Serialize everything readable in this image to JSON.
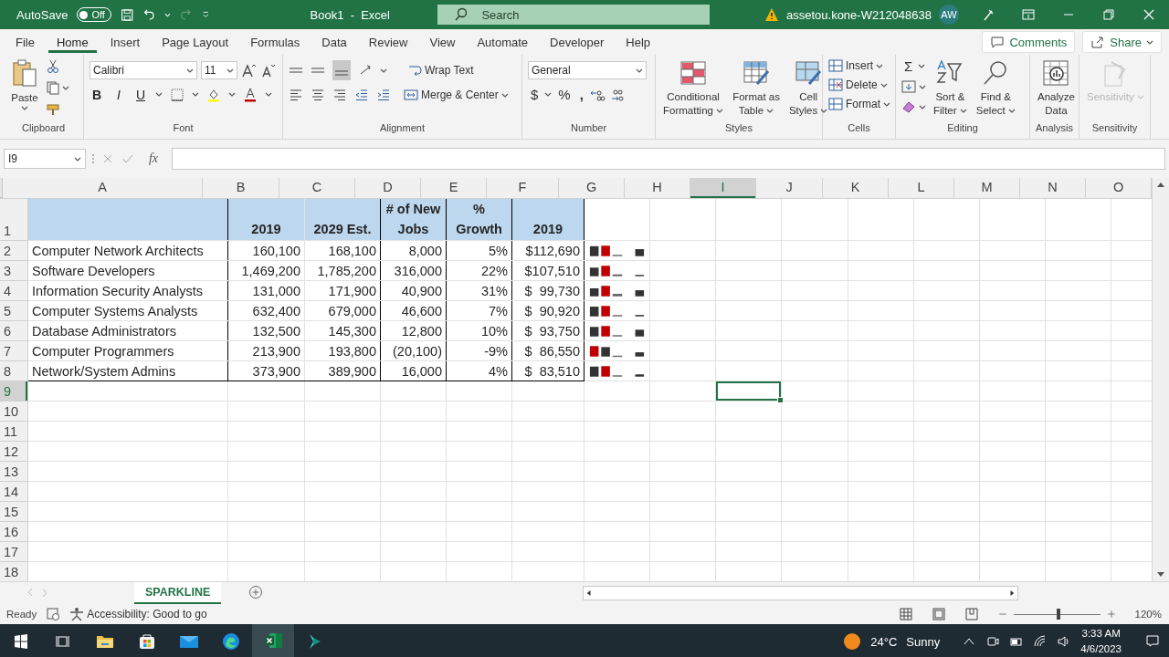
{
  "title_bar": {
    "autosave": {
      "label": "AutoSave",
      "on": false,
      "state_text": "Off"
    },
    "title": "Book1  -  Excel",
    "search": {
      "placeholder": "Search"
    },
    "account": "assetou.kone-W212048638",
    "avatar": "AW"
  },
  "menu": {
    "tabs": [
      {
        "label": "File",
        "selected": false
      },
      {
        "label": "Home",
        "selected": true
      },
      {
        "label": "Insert",
        "selected": false
      },
      {
        "label": "Page Layout",
        "selected": false
      },
      {
        "label": "Formulas",
        "selected": false
      },
      {
        "label": "Data",
        "selected": false
      },
      {
        "label": "Review",
        "selected": false
      },
      {
        "label": "View",
        "selected": false
      },
      {
        "label": "Automate",
        "selected": false
      },
      {
        "label": "Developer",
        "selected": false
      },
      {
        "label": "Help",
        "selected": false
      }
    ],
    "comments": "Comments",
    "share": "Share"
  },
  "ribbon": [
    {
      "kind": "clipboard",
      "name": "Clipboard",
      "paste": "Paste"
    },
    {
      "kind": "font",
      "name": "Font",
      "font_name": "Calibri",
      "font_size": "11",
      "styles": [
        "B",
        "I",
        "U"
      ]
    },
    {
      "kind": "alignment",
      "name": "Alignment",
      "wrap": "Wrap Text",
      "merge": "Merge & Center"
    },
    {
      "kind": "number",
      "name": "Number",
      "format": "General",
      "symbols": [
        "$",
        "%",
        ","
      ]
    },
    {
      "kind": "large",
      "name": "Styles",
      "buttons": [
        {
          "lines": [
            "Conditional",
            "Formatting"
          ],
          "caret": true,
          "disabled": false
        },
        {
          "lines": [
            "Format as",
            "Table"
          ],
          "caret": true,
          "disabled": false
        },
        {
          "lines": [
            "Cell",
            "Styles"
          ],
          "caret": true,
          "disabled": false
        }
      ]
    },
    {
      "kind": "cells",
      "name": "Cells",
      "buttons": [
        "Insert",
        "Delete",
        "Format"
      ]
    },
    {
      "kind": "editing",
      "name": "Editing",
      "sum": "Σ",
      "buttons": [
        {
          "lines": [
            "Sort &",
            "Filter"
          ],
          "caret": true,
          "disabled": false
        },
        {
          "lines": [
            "Find &",
            "Select"
          ],
          "caret": true,
          "disabled": false
        }
      ]
    },
    {
      "kind": "large",
      "name": "Analysis",
      "buttons": [
        {
          "lines": [
            "Analyze",
            "Data"
          ],
          "caret": false,
          "disabled": false
        }
      ]
    },
    {
      "kind": "large",
      "name": "Sensitivity",
      "buttons": [
        {
          "lines": [
            "Sensitivity"
          ],
          "caret": true,
          "disabled": true
        }
      ]
    }
  ],
  "formula_bar": {
    "name_box": "I9",
    "fx": "fx"
  },
  "columns": [
    {
      "label": "A",
      "selected": false
    },
    {
      "label": "B",
      "selected": false
    },
    {
      "label": "C",
      "selected": false
    },
    {
      "label": "D",
      "selected": false
    },
    {
      "label": "E",
      "selected": false
    },
    {
      "label": "F",
      "selected": false
    },
    {
      "label": "G",
      "selected": false
    },
    {
      "label": "H",
      "selected": false
    },
    {
      "label": "I",
      "selected": true
    },
    {
      "label": "J",
      "selected": false
    },
    {
      "label": "K",
      "selected": false
    },
    {
      "label": "L",
      "selected": false
    },
    {
      "label": "M",
      "selected": false
    },
    {
      "label": "N",
      "selected": false
    },
    {
      "label": "O",
      "selected": false
    }
  ],
  "rows": [
    {
      "label": "1",
      "selected": false,
      "kind": "header",
      "cells": [
        "2019",
        "2029 Est.",
        "# of New\nJobs",
        "%\nGrowth",
        "2019"
      ]
    },
    {
      "label": "2",
      "selected": false,
      "kind": "data",
      "cells": [
        "Computer Network Architects",
        "160,100",
        "168,100",
        "8,000",
        "5%",
        "$112,690"
      ]
    },
    {
      "label": "3",
      "selected": false,
      "kind": "data",
      "cells": [
        "Software Developers",
        "1,469,200",
        "1,785,200",
        "316,000",
        "22%",
        "$107,510"
      ]
    },
    {
      "label": "4",
      "selected": false,
      "kind": "data",
      "cells": [
        "Information Security Analysts",
        "131,000",
        "171,900",
        "40,900",
        "31%",
        "$  99,730"
      ]
    },
    {
      "label": "5",
      "selected": false,
      "kind": "data",
      "cells": [
        "Computer Systems Analysts",
        "632,400",
        "679,000",
        "46,600",
        "7%",
        "$  90,920"
      ]
    },
    {
      "label": "6",
      "selected": false,
      "kind": "data",
      "cells": [
        "Database Administrators",
        "132,500",
        "145,300",
        "12,800",
        "10%",
        "$  93,750"
      ]
    },
    {
      "label": "7",
      "selected": false,
      "kind": "data",
      "cells": [
        "Computer Programmers",
        "213,900",
        "193,800",
        "(20,100)",
        "-9%",
        "$  86,550"
      ]
    },
    {
      "label": "8",
      "selected": false,
      "kind": "data",
      "cells": [
        "Network/System Admins",
        "373,900",
        "389,900",
        "16,000",
        "4%",
        "$  83,510"
      ]
    },
    {
      "label": "9",
      "selected": true,
      "kind": "empty"
    },
    {
      "label": "10",
      "selected": false,
      "kind": "empty"
    },
    {
      "label": "11",
      "selected": false,
      "kind": "empty"
    },
    {
      "label": "12",
      "selected": false,
      "kind": "empty"
    },
    {
      "label": "13",
      "selected": false,
      "kind": "empty"
    },
    {
      "label": "14",
      "selected": false,
      "kind": "empty"
    },
    {
      "label": "15",
      "selected": false,
      "kind": "empty"
    },
    {
      "label": "16",
      "selected": false,
      "kind": "empty"
    },
    {
      "label": "17",
      "selected": false,
      "kind": "empty"
    },
    {
      "label": "18",
      "selected": false,
      "kind": "empty"
    }
  ],
  "sheet_tabs": [
    {
      "label": "SPARKLINE",
      "selected": true
    }
  ],
  "status_bar": {
    "ready": "Ready",
    "accessibility": "Accessibility: Good to go",
    "zoom_slider": {
      "level": 0.52
    },
    "zoom": "120%"
  },
  "taskbar": {
    "apps": [
      {
        "kind": "start",
        "active": false
      },
      {
        "kind": "taskview",
        "active": false
      },
      {
        "kind": "explorer",
        "active": false
      },
      {
        "kind": "store",
        "active": false
      },
      {
        "kind": "mail",
        "active": false
      },
      {
        "kind": "edge",
        "active": false
      },
      {
        "kind": "excel",
        "active": true
      },
      {
        "kind": "editor",
        "active": false
      }
    ],
    "weather": {
      "temp": "24°C",
      "condition": "Sunny"
    },
    "clock": {
      "time": "3:33 AM",
      "date": "4/6/2023"
    }
  }
}
